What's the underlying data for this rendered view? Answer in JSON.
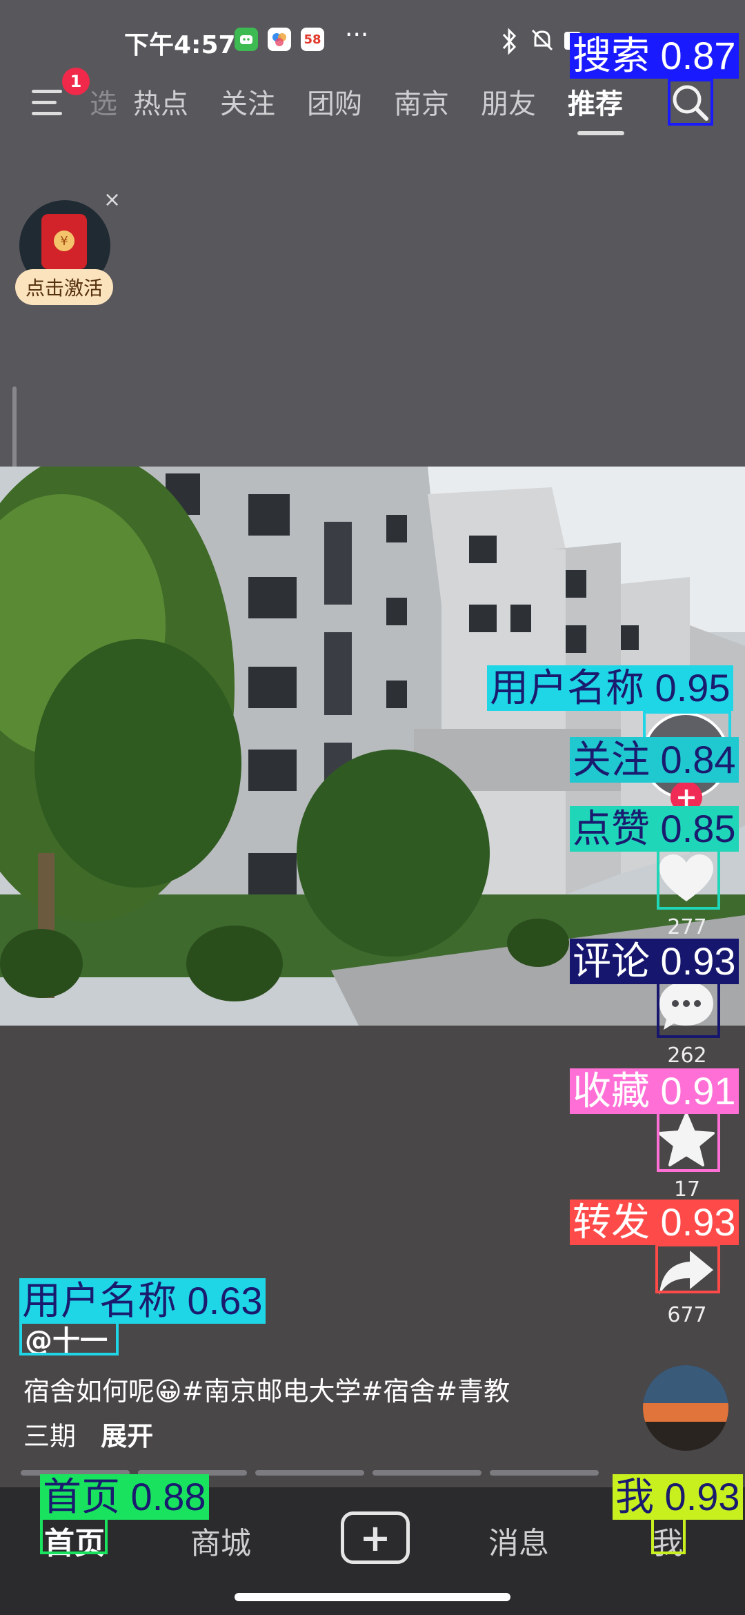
{
  "status_bar": {
    "time": "下午4:57",
    "more": "···",
    "icons": [
      "app-green-icon",
      "app-clover-icon",
      "app-58-icon",
      "bluetooth-icon",
      "mute-bell-icon",
      "battery-icon"
    ],
    "app58_text": "58"
  },
  "top_nav": {
    "badge": "1",
    "tabs": [
      {
        "label": "热点"
      },
      {
        "label": "关注"
      },
      {
        "label": "团购"
      },
      {
        "label": "南京"
      },
      {
        "label": "朋友"
      },
      {
        "label": "推荐",
        "active": true
      }
    ],
    "partial_tab": "选"
  },
  "widget": {
    "close": "×",
    "coin": "¥",
    "label": "点击激活"
  },
  "rail": {
    "follow_plus": "+",
    "like_count": "277",
    "comment_count": "262",
    "favorite_count": "17",
    "share_count": "677"
  },
  "post": {
    "author": "@十一",
    "caption_line1": "宿舍如何呢😀#南京邮电大学#宿舍#青教",
    "caption_line2": "三期",
    "expand": "展开"
  },
  "bottom_nav": {
    "home": "首页",
    "mall": "商城",
    "create": "+",
    "messages": "消息",
    "me": "我"
  },
  "detections": [
    {
      "label": "搜索 0.87",
      "color": "#1a1aff"
    },
    {
      "label": "用户名称 0.95",
      "color": "#1fd6e6"
    },
    {
      "label": "关注 0.84",
      "color": "#20c8d0"
    },
    {
      "label": "点赞 0.85",
      "color": "#1fd6b8"
    },
    {
      "label": "评论 0.93",
      "color": "#16166e"
    },
    {
      "label": "收藏 0.91",
      "color": "#ff6fd6"
    },
    {
      "label": "转发 0.93",
      "color": "#ff4a4a"
    },
    {
      "label": "用户名称 0.63",
      "color": "#1fd6e6"
    },
    {
      "label": "首页 0.88",
      "color": "#19e35e"
    },
    {
      "label": "我 0.93",
      "color": "#c8f01f"
    }
  ],
  "colors": {
    "accent_red": "#f02b55",
    "background": "#48474b"
  }
}
